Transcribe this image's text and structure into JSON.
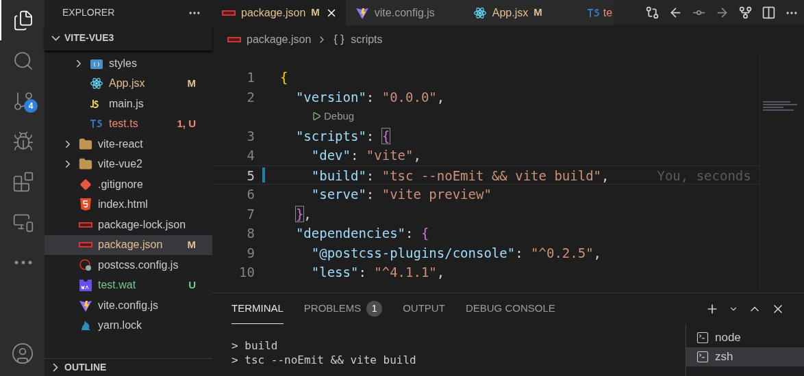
{
  "activity_bar": {
    "items": [
      {
        "kind": "files",
        "selected": true
      },
      {
        "kind": "search",
        "selected": false
      },
      {
        "kind": "source-control",
        "selected": false,
        "badge": "4"
      },
      {
        "kind": "run-debug",
        "selected": false
      },
      {
        "kind": "extensions",
        "selected": false
      },
      {
        "kind": "remote",
        "selected": false
      },
      {
        "kind": "more",
        "selected": false
      }
    ],
    "bottom": [
      {
        "kind": "account",
        "selected": false
      }
    ]
  },
  "sidebar": {
    "title": "EXPLORER",
    "section": {
      "label": "VITE-VUE3",
      "expanded": true
    },
    "items": [
      {
        "children": [
          {
            "label": "styles",
            "kind": "folder-styles",
            "expanded": false,
            "color": "#cccccc",
            "selected": false
          },
          {
            "label": "App.jsx",
            "kind": "react",
            "color": "#e2c08d",
            "status": "M",
            "selected": false
          },
          {
            "label": "main.js",
            "kind": "js",
            "color": "#cccccc",
            "selected": false
          },
          {
            "label": "test.ts",
            "kind": "ts",
            "color": "#f48771",
            "status": "1, U",
            "selected": false
          }
        ]
      },
      {
        "label": "vite-react",
        "kind": "folder",
        "expanded": false,
        "color": "#cccccc",
        "selected": false
      },
      {
        "label": "vite-vue2",
        "kind": "folder",
        "expanded": false,
        "color": "#cccccc",
        "selected": false
      },
      {
        "label": ".gitignore",
        "kind": "git",
        "color": "#cccccc",
        "selected": false
      },
      {
        "label": "index.html",
        "kind": "html",
        "color": "#cccccc",
        "selected": false
      },
      {
        "label": "package-lock.json",
        "kind": "npm",
        "color": "#cccccc",
        "selected": false
      },
      {
        "label": "package.json",
        "kind": "npm",
        "color": "#e2c08d",
        "status": "M",
        "selected": true
      },
      {
        "label": "postcss.config.js",
        "kind": "postcss",
        "color": "#cccccc",
        "selected": false
      },
      {
        "label": "test.wat",
        "kind": "wasm",
        "color": "#73c991",
        "status": "U",
        "selected": false
      },
      {
        "label": "vite.config.js",
        "kind": "vite",
        "color": "#cccccc",
        "selected": false
      },
      {
        "label": "yarn.lock",
        "kind": "yarn",
        "color": "#cccccc",
        "selected": false
      }
    ],
    "outline": {
      "label": "OUTLINE",
      "expanded": false
    }
  },
  "tabs": [
    {
      "label": "package.json",
      "kind": "npm",
      "color": "#e2c08d",
      "status": "M",
      "selected": true
    },
    {
      "label": "vite.config.js",
      "kind": "vite",
      "color": "#9d9d9d",
      "selected": false
    },
    {
      "label": "App.jsx",
      "kind": "react",
      "color": "#e2c08d",
      "status": "M",
      "selected": false
    },
    {
      "label": "te",
      "kind": "ts",
      "color": "#f48771",
      "selected": false
    }
  ],
  "editor_actions": [
    {
      "kind": "compare"
    },
    {
      "kind": "previous-change"
    },
    {
      "kind": "commit"
    },
    {
      "kind": "next-change"
    },
    {
      "kind": "branch"
    },
    {
      "kind": "split"
    }
  ],
  "breadcrumb": [
    {
      "kind": "npm",
      "text": "package.json"
    },
    {
      "kind": "braces",
      "text": "scripts"
    }
  ],
  "editor": {
    "lines": [
      {
        "kind": "code",
        "number": "1",
        "current": false,
        "modified": false,
        "tokens": [
          {
            "kind": "brace",
            "text": "{"
          }
        ]
      },
      {
        "kind": "code",
        "number": "2",
        "current": false,
        "modified": false,
        "tokens": [
          {
            "kind": "key",
            "text": "  \"version\""
          },
          {
            "kind": "punct",
            "text": ": "
          },
          {
            "kind": "string",
            "text": "\"0.0.0\""
          },
          {
            "kind": "punct",
            "text": ","
          }
        ]
      },
      {
        "kind": "codelens",
        "text": "Debug"
      },
      {
        "kind": "code",
        "number": "3",
        "current": false,
        "modified": false,
        "tokens": [
          {
            "kind": "key",
            "text": "  \"scripts\""
          },
          {
            "kind": "punct",
            "text": ": "
          },
          {
            "kind": "brace2",
            "text": "{",
            "matched": true
          }
        ]
      },
      {
        "kind": "code",
        "number": "4",
        "current": false,
        "modified": false,
        "tokens": [
          {
            "kind": "key",
            "text": "    \"dev\""
          },
          {
            "kind": "punct",
            "text": ": "
          },
          {
            "kind": "string",
            "text": "\"vite\""
          },
          {
            "kind": "punct",
            "text": ","
          }
        ]
      },
      {
        "kind": "code",
        "number": "5",
        "current": true,
        "modified": true,
        "blame": "You, seconds",
        "tokens": [
          {
            "kind": "key",
            "text": "    \"build\""
          },
          {
            "kind": "punct",
            "text": ": "
          },
          {
            "kind": "string",
            "text": "\"tsc --noEmit && vite build\""
          },
          {
            "kind": "punct",
            "text": ","
          }
        ]
      },
      {
        "kind": "code",
        "number": "6",
        "current": false,
        "modified": false,
        "tokens": [
          {
            "kind": "key",
            "text": "    \"serve\""
          },
          {
            "kind": "punct",
            "text": ": "
          },
          {
            "kind": "string",
            "text": "\"vite preview\""
          }
        ]
      },
      {
        "kind": "code",
        "number": "7",
        "current": false,
        "modified": false,
        "tokens": [
          {
            "kind": "brace2",
            "text": "  }",
            "matched": true
          },
          {
            "kind": "punct",
            "text": ","
          }
        ]
      },
      {
        "kind": "code",
        "number": "8",
        "current": false,
        "modified": false,
        "tokens": [
          {
            "kind": "key",
            "text": "  \"dependencies\""
          },
          {
            "kind": "punct",
            "text": ": "
          },
          {
            "kind": "brace2",
            "text": "{",
            "matched": false
          }
        ]
      },
      {
        "kind": "code",
        "number": "9",
        "current": false,
        "modified": false,
        "tokens": [
          {
            "kind": "key",
            "text": "    \"@postcss-plugins/console\""
          },
          {
            "kind": "punct",
            "text": ": "
          },
          {
            "kind": "string",
            "text": "\"^0.2.5\""
          },
          {
            "kind": "punct",
            "text": ","
          }
        ]
      },
      {
        "kind": "code",
        "number": "10",
        "current": false,
        "modified": false,
        "tokens": [
          {
            "kind": "key",
            "text": "    \"less\""
          },
          {
            "kind": "punct",
            "text": ": "
          },
          {
            "kind": "string",
            "text": "\"^4.1.1\""
          },
          {
            "kind": "punct",
            "text": ","
          }
        ]
      }
    ]
  },
  "panel": {
    "tabs": [
      {
        "label": "TERMINAL",
        "selected": true
      },
      {
        "label": "PROBLEMS",
        "badge": "1",
        "selected": false
      },
      {
        "label": "OUTPUT",
        "selected": false
      },
      {
        "label": "DEBUG CONSOLE",
        "selected": false
      }
    ],
    "actions": [
      {
        "kind": "add"
      },
      {
        "kind": "dropdown"
      },
      {
        "kind": "maximize"
      },
      {
        "kind": "close"
      }
    ],
    "output": [
      "> build",
      "> tsc --noEmit && vite build"
    ],
    "terminals": [
      {
        "label": "node",
        "selected": false
      },
      {
        "label": "zsh",
        "selected": true
      }
    ]
  }
}
